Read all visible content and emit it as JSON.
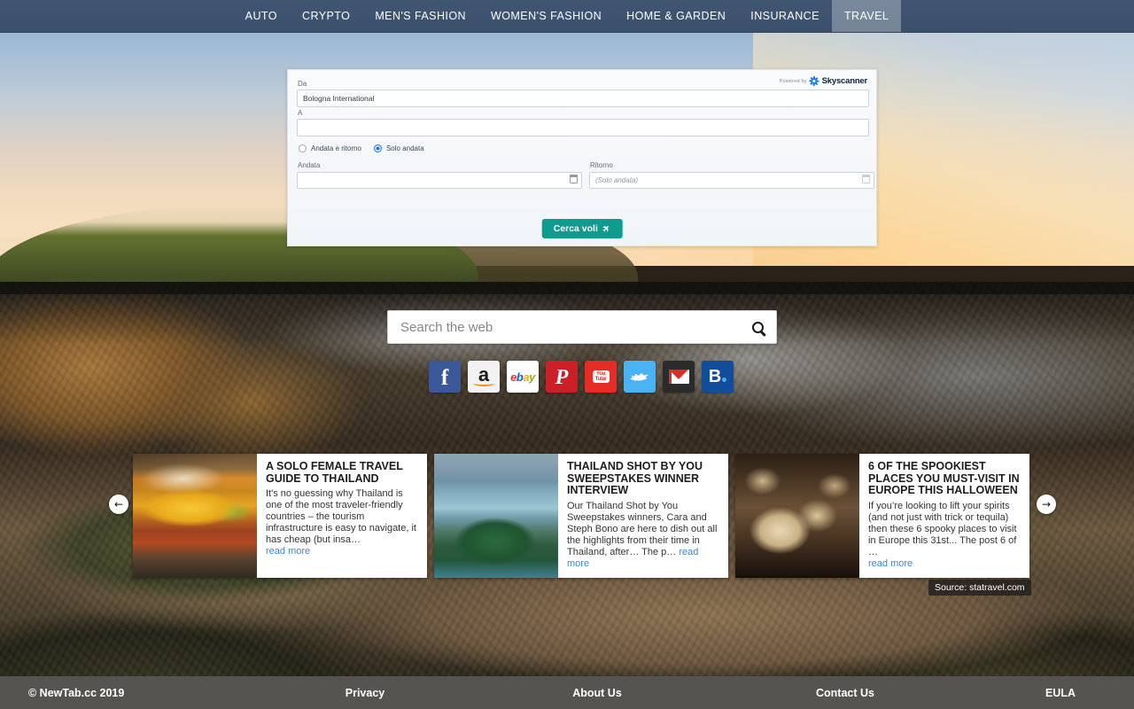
{
  "nav": {
    "items": [
      {
        "label": "AUTO",
        "active": false
      },
      {
        "label": "CRYPTO",
        "active": false
      },
      {
        "label": "MEN'S FASHION",
        "active": false
      },
      {
        "label": "WOMEN'S FASHION",
        "active": false
      },
      {
        "label": "HOME & GARDEN",
        "active": false
      },
      {
        "label": "INSURANCE",
        "active": false
      },
      {
        "label": "TRAVEL",
        "active": true
      }
    ],
    "background_color": "#3d5370",
    "active_background_color": "#7b879a"
  },
  "flight_widget": {
    "powered_by_text": "Powered by",
    "brand": "Skyscanner",
    "from_label": "Da",
    "from_value": "Bologna International",
    "from_placeholder": "",
    "to_label": "A",
    "to_value": "",
    "to_placeholder": "",
    "trip_options": [
      {
        "label": "Andata e ritorno",
        "selected": false
      },
      {
        "label": "Solo andata",
        "selected": true
      }
    ],
    "depart_label": "Andata",
    "depart_value": "",
    "depart_placeholder": "",
    "return_label": "Ritorno",
    "return_value": "",
    "return_placeholder": "(Solo andata)",
    "search_button_label": "Cerca voli",
    "search_button_color": "#0f9b8e",
    "radio_selected_color": "#1675e0"
  },
  "web_search": {
    "placeholder": "Search the web",
    "value": ""
  },
  "shortcuts": [
    {
      "name": "facebook",
      "label": "f"
    },
    {
      "name": "amazon",
      "label": "a"
    },
    {
      "name": "ebay",
      "letters": [
        "e",
        "b",
        "a",
        "y"
      ]
    },
    {
      "name": "pinterest",
      "label": "P"
    },
    {
      "name": "youtube",
      "line1": "You",
      "line2": "Tube"
    },
    {
      "name": "twitter",
      "label": ""
    },
    {
      "name": "gmail",
      "label": ""
    },
    {
      "name": "booking",
      "label": "B"
    }
  ],
  "carousel": {
    "prev_label": "←",
    "next_label": "→",
    "source_badge": "Source: statravel.com",
    "read_more_label": "read more",
    "cards": [
      {
        "thumb": "thumb-market",
        "title": "A SOLO FEMALE TRAVEL GUIDE TO THAILAND",
        "text": "It's no guessing why Thailand is one of the most traveler-friendly countries – the tourism infrastructure is easy to navigate, it has cheap (but insa…",
        "read_more_inline": false
      },
      {
        "thumb": "thumb-islands",
        "title": "THAILAND SHOT BY YOU SWEEPSTAKES WINNER INTERVIEW",
        "text": "Our Thailand Shot by You Sweepstakes winners, Cara and Steph Bono are here to dish out all the highlights from their time in Thailand, after… The p…",
        "read_more_inline": true
      },
      {
        "thumb": "thumb-skulls",
        "title": "6 OF THE SPOOKIEST PLACES YOU MUST-VISIT IN EUROPE THIS HALLOWEEN",
        "text": "If you’re looking to lift your spirits (and not just with trick or tequila) then these 6 spooky places to visit in Europe this 31st... The post 6 of …",
        "read_more_inline": false
      }
    ]
  },
  "footer": {
    "copyright": "© NewTab.cc 2019",
    "links": [
      {
        "label": "Privacy"
      },
      {
        "label": "About Us"
      },
      {
        "label": "Contact Us"
      },
      {
        "label": "EULA"
      }
    ],
    "background_color": "#565450"
  }
}
